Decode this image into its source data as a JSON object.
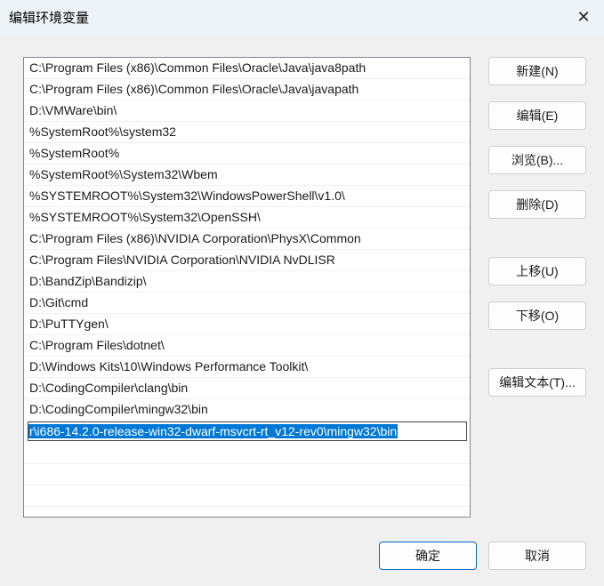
{
  "window": {
    "title": "编辑环境变量",
    "close_icon": "close-icon"
  },
  "list": {
    "items": [
      "C:\\Program Files (x86)\\Common Files\\Oracle\\Java\\java8path",
      "C:\\Program Files (x86)\\Common Files\\Oracle\\Java\\javapath",
      "D:\\VMWare\\bin\\",
      "%SystemRoot%\\system32",
      "%SystemRoot%",
      "%SystemRoot%\\System32\\Wbem",
      "%SYSTEMROOT%\\System32\\WindowsPowerShell\\v1.0\\",
      "%SYSTEMROOT%\\System32\\OpenSSH\\",
      "C:\\Program Files (x86)\\NVIDIA Corporation\\PhysX\\Common",
      "C:\\Program Files\\NVIDIA Corporation\\NVIDIA NvDLISR",
      "D:\\BandZip\\Bandizip\\",
      "D:\\Git\\cmd",
      "D:\\PuTTYgen\\",
      "C:\\Program Files\\dotnet\\",
      "D:\\Windows Kits\\10\\Windows Performance Toolkit\\",
      "D:\\CodingCompiler\\clang\\bin",
      "D:\\CodingCompiler\\mingw32\\bin"
    ],
    "editing_value": "r\\i686-14.2.0-release-win32-dwarf-msvcrt-rt_v12-rev0\\mingw32\\bin"
  },
  "buttons": {
    "new": "新建(N)",
    "edit": "编辑(E)",
    "browse": "浏览(B)...",
    "delete": "删除(D)",
    "move_up": "上移(U)",
    "move_down": "下移(O)",
    "edit_text": "编辑文本(T)...",
    "ok": "确定",
    "cancel": "取消"
  }
}
